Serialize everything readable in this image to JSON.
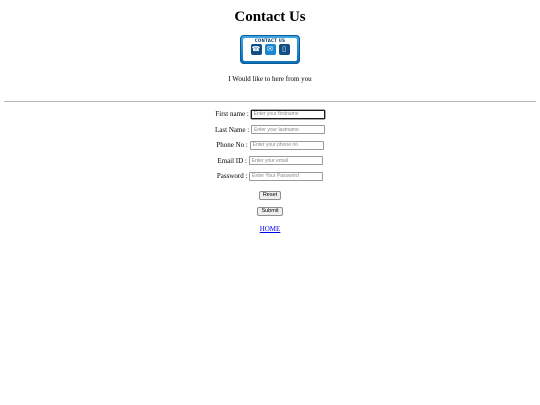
{
  "page": {
    "title": "Contact Us",
    "subtitle": "I Would like to here from you"
  },
  "logo": {
    "text": "CONTACT US",
    "icons": [
      "phone-icon",
      "mail-icon",
      "mobile-icon"
    ]
  },
  "form": {
    "fields": [
      {
        "label": "First name :",
        "placeholder": "Enter your firstname",
        "type": "text"
      },
      {
        "label": "Last Name :",
        "placeholder": "Enter your lastname",
        "type": "text"
      },
      {
        "label": "Phone No :",
        "placeholder": "Enter your phone no",
        "type": "text"
      },
      {
        "label": "Email ID :",
        "placeholder": "Enter your email",
        "type": "email"
      },
      {
        "label": "Password :",
        "placeholder": "Enter Your Password",
        "type": "password"
      }
    ],
    "reset_label": "Reset",
    "submit_label": "Submit"
  },
  "nav": {
    "home_label": "HOME"
  },
  "colors": {
    "link": "#0000ee",
    "divider": "#b8b8b8",
    "logo_blue": "#1c86d1"
  }
}
